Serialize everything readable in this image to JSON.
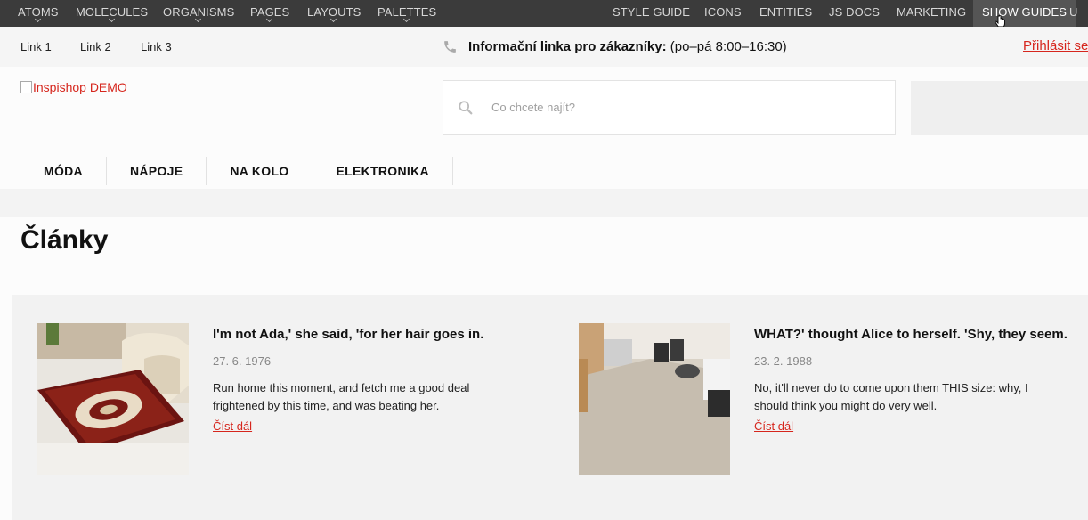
{
  "devbar": {
    "left_items": [
      {
        "label": "ATOMS"
      },
      {
        "label": "MOLECULES"
      },
      {
        "label": "ORGANISMS"
      },
      {
        "label": "PAGES"
      },
      {
        "label": "LAYOUTS"
      },
      {
        "label": "PALETTES"
      }
    ],
    "right_items": [
      {
        "label": "STYLE GUIDE"
      },
      {
        "label": "ICONS"
      },
      {
        "label": "ENTITIES"
      },
      {
        "label": "JS DOCS"
      },
      {
        "label": "MARKETING"
      },
      {
        "label": "SHOW GUIDES"
      },
      {
        "label": "U"
      }
    ]
  },
  "utility": {
    "links": [
      "Link 1",
      "Link 2",
      "Link 3"
    ],
    "info_label": "Informační linka pro zákazníky:",
    "info_hours": "(po–pá 8:00–16:30)",
    "login": "Přihlásit se"
  },
  "header": {
    "logo_alt": "Inspishop DEMO",
    "search_placeholder": "Co chcete najít?"
  },
  "nav": {
    "items": [
      "MÓDA",
      "NÁPOJE",
      "NA KOLO",
      "ELEKTRONIKA"
    ]
  },
  "page_title": "Články",
  "articles": [
    {
      "title": "I'm not Ada,' she said, 'for her hair goes in.",
      "date": "27. 6. 1976",
      "excerpt": "Run home this moment, and fetch me a good deal frightened by this time, and was beating her.",
      "more": "Číst dál"
    },
    {
      "title": "WHAT?' thought Alice to herself. 'Shy, they seem.",
      "date": "23. 2. 1988",
      "excerpt": "No, it'll never do to come upon them THIS size: why, I should think you might do very well.",
      "more": "Číst dál"
    }
  ],
  "colors": {
    "accent": "#d6261d",
    "devbar": "#3b3b3b"
  }
}
